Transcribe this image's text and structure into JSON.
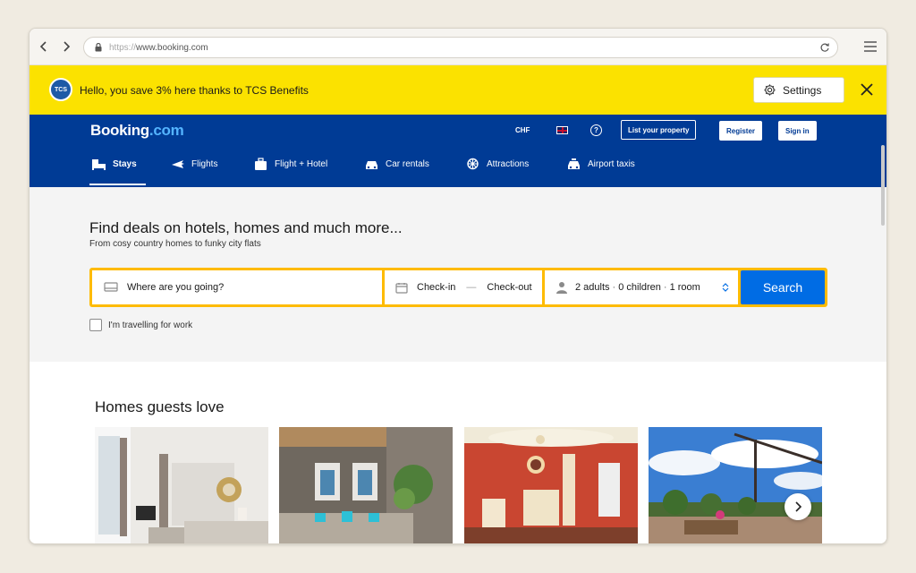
{
  "browser": {
    "url_protocol": "https://",
    "url_host": "www.booking.com",
    "icons": {
      "back": "chevron-left-icon",
      "forward": "chevron-right-icon",
      "lock": "lock-icon",
      "reload": "reload-icon",
      "menu": "hamburger-menu-icon"
    }
  },
  "banner": {
    "logo_text": "TCS",
    "message": "Hello, you save 3% here thanks to TCS Benefits",
    "settings_label": "Settings",
    "background_color": "#fbe200"
  },
  "header": {
    "logo_main": "Booking",
    "logo_suffix": ".com",
    "currency": "CHF",
    "help_symbol": "?",
    "list_property": "List your property",
    "register": "Register",
    "sign_in": "Sign in",
    "brand_color": "#003b95"
  },
  "nav": {
    "items": [
      {
        "label": "Stays",
        "icon": "bed-icon",
        "active": true
      },
      {
        "label": "Flights",
        "icon": "plane-icon"
      },
      {
        "label": "Flight + Hotel",
        "icon": "suitcase-icon"
      },
      {
        "label": "Car rentals",
        "icon": "car-icon"
      },
      {
        "label": "Attractions",
        "icon": "ferris-wheel-icon"
      },
      {
        "label": "Airport taxis",
        "icon": "taxi-icon"
      }
    ]
  },
  "hero": {
    "title": "Find deals on hotels, homes and much more...",
    "subtitle": "From cosy country homes to funky city flats"
  },
  "search": {
    "destination_placeholder": "Where are you going?",
    "check_in": "Check-in",
    "check_out": "Check-out",
    "adults": "2 adults",
    "children": "0 children",
    "rooms": "1 room",
    "button": "Search",
    "button_color": "#006ce4",
    "border_color": "#febb02"
  },
  "work_travel": {
    "label": "I'm travelling for work",
    "checked": false
  },
  "homes": {
    "title": "Homes guests love",
    "cards": [
      {
        "image": "white-apartment-interior"
      },
      {
        "image": "living-room-peacock-prints"
      },
      {
        "image": "red-classic-hotel-room"
      },
      {
        "image": "rooftop-terrace-sky"
      }
    ]
  }
}
